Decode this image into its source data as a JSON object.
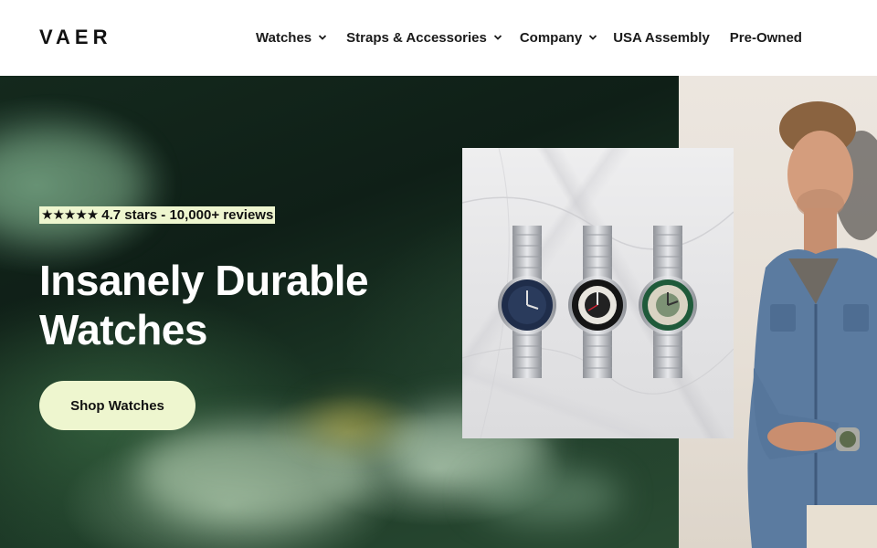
{
  "brand": {
    "logo": "VAER"
  },
  "nav": {
    "items": [
      {
        "label": "Watches",
        "has_dropdown": true,
        "icon": "chevron-down-icon"
      },
      {
        "label": "Straps & Accessories",
        "has_dropdown": true,
        "icon": "chevron-down-icon"
      },
      {
        "label": "Company",
        "has_dropdown": true,
        "icon": "chevron-down-icon"
      },
      {
        "label": "USA Assembly",
        "has_dropdown": false
      },
      {
        "label": "Pre-Owned",
        "has_dropdown": false
      }
    ]
  },
  "hero": {
    "rating": {
      "stars": "★★★★★",
      "text": "4.7 stars - 10,000+ reviews",
      "value": 4.7,
      "max": 5
    },
    "headline_line1": "Insanely Durable",
    "headline_line2": "Watches",
    "cta_label": "Shop Watches",
    "product_image": "three-steel-watches-on-marble",
    "model_image": "man-in-denim-jacket-wearing-watch"
  },
  "colors": {
    "accent": "#eef6cf",
    "text_dark": "#111111",
    "hero_dark_green": "#14291d",
    "watch_blue_dial": "#1f2d4a",
    "watch_green_bezel": "#1f5a3a",
    "watch_black_bezel": "#151515"
  }
}
